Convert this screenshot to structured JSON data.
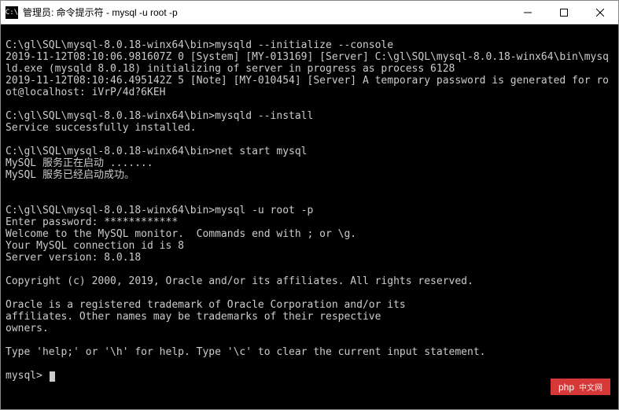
{
  "titlebar": {
    "icon_text": "C:\\",
    "title": "管理员: 命令提示符 - mysql  -u root -p"
  },
  "terminal": {
    "lines": "\nC:\\gl\\SQL\\mysql-8.0.18-winx64\\bin>mysqld --initialize --console\n2019-11-12T08:10:06.981607Z 0 [System] [MY-013169] [Server] C:\\gl\\SQL\\mysql-8.0.18-winx64\\bin\\mysqld.exe (mysqld 8.0.18) initializing of server in progress as process 6128\n2019-11-12T08:10:46.495142Z 5 [Note] [MY-010454] [Server] A temporary password is generated for root@localhost: iVrP/4d?6KEH\n\nC:\\gl\\SQL\\mysql-8.0.18-winx64\\bin>mysqld --install\nService successfully installed.\n\nC:\\gl\\SQL\\mysql-8.0.18-winx64\\bin>net start mysql\nMySQL 服务正在启动 .......\nMySQL 服务已经启动成功。\n\n\nC:\\gl\\SQL\\mysql-8.0.18-winx64\\bin>mysql -u root -p\nEnter password: ************\nWelcome to the MySQL monitor.  Commands end with ; or \\g.\nYour MySQL connection id is 8\nServer version: 8.0.18\n\nCopyright (c) 2000, 2019, Oracle and/or its affiliates. All rights reserved.\n\nOracle is a registered trademark of Oracle Corporation and/or its\naffiliates. Other names may be trademarks of their respective\nowners.\n\nType 'help;' or '\\h' for help. Type '\\c' to clear the current input statement.\n\nmysql> "
  },
  "watermark": {
    "text": "php",
    "cn": "中文网"
  }
}
